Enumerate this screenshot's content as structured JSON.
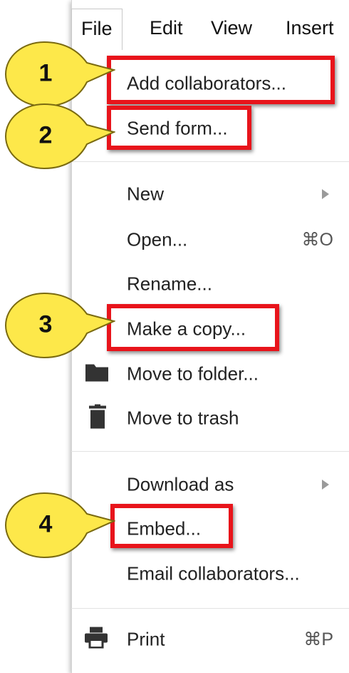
{
  "menubar": {
    "tabs": [
      "File",
      "Edit",
      "View",
      "Insert"
    ]
  },
  "file_menu": {
    "add_collaborators": "Add collaborators...",
    "send_form": "Send form...",
    "new": "New",
    "open": "Open...",
    "open_shortcut": "⌘O",
    "rename": "Rename...",
    "make_copy": "Make a copy...",
    "move_to_folder": "Move to folder...",
    "move_to_trash": "Move to trash",
    "download_as": "Download as",
    "embed": "Embed...",
    "email_collaborators": "Email collaborators...",
    "print": "Print",
    "print_shortcut": "⌘P"
  },
  "callouts": [
    "1",
    "2",
    "3",
    "4"
  ],
  "colors": {
    "highlight": "#e8141b",
    "callout_fill": "#fde84a",
    "callout_border": "#7a6a10"
  },
  "icons": [
    "folder-icon",
    "trash-icon",
    "printer-icon",
    "submenu-arrow-icon"
  ]
}
